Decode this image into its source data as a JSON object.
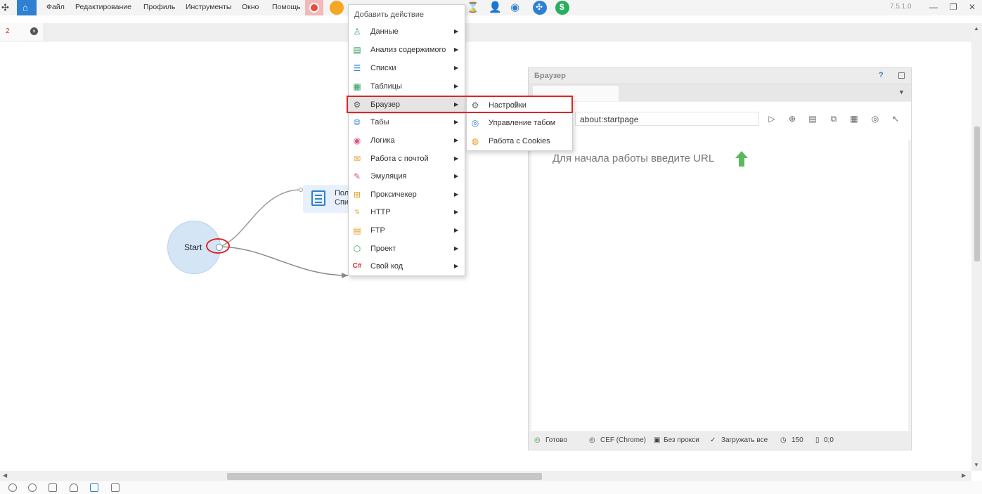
{
  "app": {
    "version": "7.5.1.0",
    "menu": [
      "Файл",
      "Редактирование",
      "Профиль",
      "Инструменты",
      "Окно",
      "Помощь"
    ]
  },
  "document_tab": {
    "number": "2"
  },
  "canvas": {
    "start_label": "Start",
    "list_node_text": "Пол\nСпи"
  },
  "context_menu": {
    "header": "Добавить действие",
    "items": [
      {
        "label": "Данные",
        "icon": "person-icon"
      },
      {
        "label": "Анализ содержимого",
        "icon": "document-analysis-icon"
      },
      {
        "label": "Списки",
        "icon": "list-icon"
      },
      {
        "label": "Таблицы",
        "icon": "table-icon"
      },
      {
        "label": "Браузер",
        "icon": "gear-icon"
      },
      {
        "label": "Табы",
        "icon": "globe-icon"
      },
      {
        "label": "Логика",
        "icon": "logic-icon"
      },
      {
        "label": "Работа с почтой",
        "icon": "mail-icon"
      },
      {
        "label": "Эмуляция",
        "icon": "emulation-icon"
      },
      {
        "label": "Проксичекер",
        "icon": "proxy-icon"
      },
      {
        "label": "HTTP",
        "icon": "http-icon"
      },
      {
        "label": "FTP",
        "icon": "ftp-icon"
      },
      {
        "label": "Проект",
        "icon": "cube-icon"
      },
      {
        "label": "Свой код",
        "icon": "csharp-icon"
      }
    ]
  },
  "submenu": {
    "items": [
      {
        "label": "Настройки",
        "icon": "gear-icon"
      },
      {
        "label": "Управление табом",
        "icon": "tab-icon"
      },
      {
        "label": "Работа с Cookies",
        "icon": "cookie-icon"
      }
    ]
  },
  "browser_panel": {
    "title": "Браузер",
    "help": "?",
    "url": "about:startpage",
    "prompt": "Для начала работы введите URL",
    "status": {
      "ready": "Готово",
      "engine": "CEF (Chrome)",
      "proxy": "Без прокси",
      "load": "Загружать все",
      "timer": "150",
      "coords": "0;0"
    }
  },
  "colors": {
    "accent_blue": "#2f80d1",
    "highlight_red": "#e02424",
    "node_fill": "#d4e6f6"
  }
}
